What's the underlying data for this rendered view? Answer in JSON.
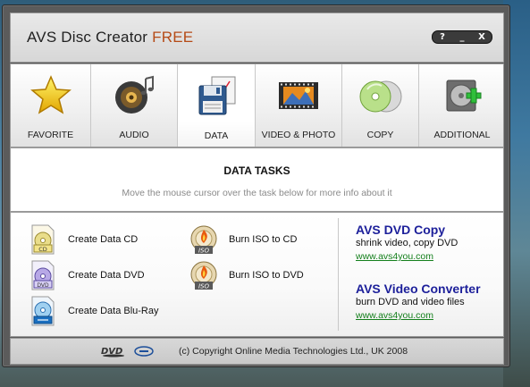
{
  "window": {
    "title_main": "AVS Disc Creator",
    "title_accent": "FREE",
    "controls": {
      "help": "?",
      "minimize": "_",
      "close": "X"
    }
  },
  "toolbar": {
    "tabs": [
      {
        "label": "FAVORITE",
        "icon": "star-icon"
      },
      {
        "label": "AUDIO",
        "icon": "speaker-icon"
      },
      {
        "label": "DATA",
        "icon": "floppy-disk-icon",
        "active": true
      },
      {
        "label": "VIDEO & PHOTO",
        "icon": "film-strip-icon"
      },
      {
        "label": "COPY",
        "icon": "discs-icon"
      },
      {
        "label": "ADDITIONAL",
        "icon": "add-disc-icon"
      }
    ]
  },
  "tasks": {
    "title": "DATA TASKS",
    "hint": "Move the mouse cursor over the task below for more info about it",
    "items": [
      {
        "label": "Create Data CD",
        "icon": "cd-disc-icon"
      },
      {
        "label": "Create Data DVD",
        "icon": "dvd-disc-icon"
      },
      {
        "label": "Create Data Blu-Ray",
        "icon": "bluray-disc-icon"
      },
      {
        "label": "Burn ISO to CD",
        "icon": "iso-burn-icon"
      },
      {
        "label": "Burn ISO to DVD",
        "icon": "iso-burn-icon"
      }
    ]
  },
  "promos": [
    {
      "heading": "AVS DVD Copy",
      "description": "shrink video, copy DVD",
      "link": "www.avs4you.com"
    },
    {
      "heading": "AVS Video Converter",
      "description": "burn DVD and video files",
      "link": "www.avs4you.com"
    }
  ],
  "footer": {
    "copyright": "(c) Copyright Online Media Technologies Ltd., UK 2008",
    "logos": [
      "dvd-logo-icon",
      "bluray-logo-icon"
    ]
  },
  "colors": {
    "accent": "#b54a16",
    "promo_heading": "#1c1f9a",
    "promo_link": "#137f1b"
  }
}
